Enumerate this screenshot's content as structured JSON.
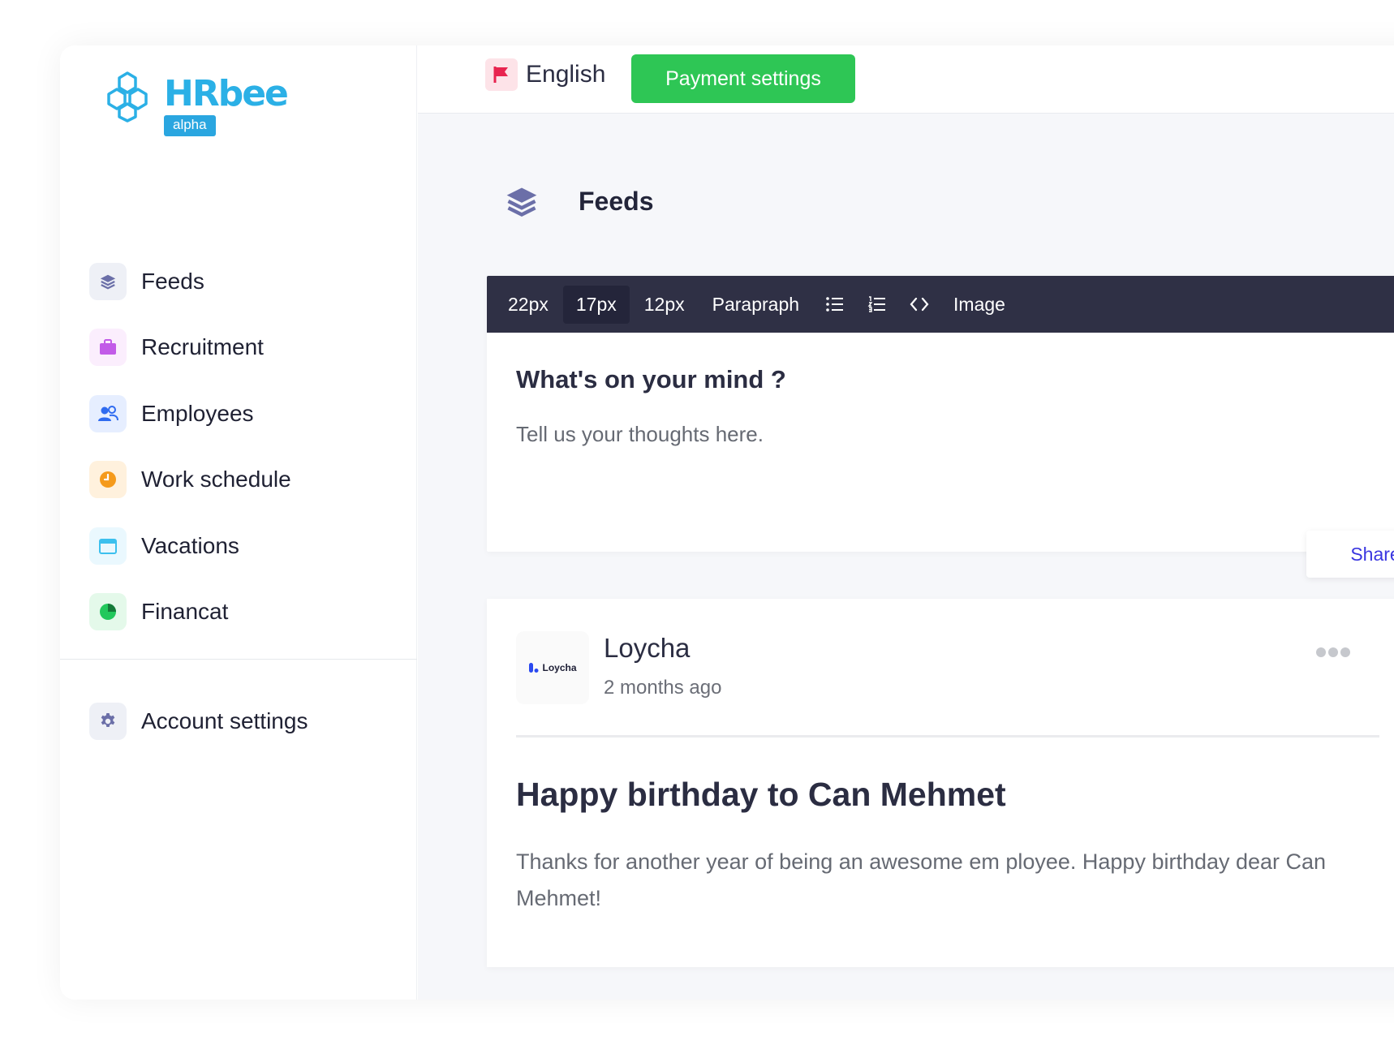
{
  "brand": {
    "name": "HRbee",
    "badge": "alpha"
  },
  "sidebar": {
    "items": [
      {
        "label": "Feeds",
        "icon": "layers-icon",
        "color": "#6b6fa8",
        "bg": "#eef0f6"
      },
      {
        "label": "Recruitment",
        "icon": "briefcase-icon",
        "color": "#c25be8",
        "bg": "#fbeefd"
      },
      {
        "label": "Employees",
        "icon": "users-icon",
        "color": "#2f6bf0",
        "bg": "#e6eeff"
      },
      {
        "label": "Work schedule",
        "icon": "clock-icon",
        "color": "#f59a1b",
        "bg": "#fff1dd"
      },
      {
        "label": "Vacations",
        "icon": "calendar-icon",
        "color": "#3cc0ee",
        "bg": "#eaf8fe"
      },
      {
        "label": "Financat",
        "icon": "pie-chart-icon",
        "color": "#22c85c",
        "bg": "#e4f9ea"
      }
    ],
    "settings": {
      "label": "Account settings",
      "icon": "gear-icon"
    }
  },
  "topbar": {
    "language": "English",
    "payment_button": "Payment settings"
  },
  "page": {
    "title": "Feeds"
  },
  "editor": {
    "toolbar": [
      "22px",
      "17px",
      "12px",
      "Parapraph"
    ],
    "toolbar_active": "17px",
    "image_label": "Image",
    "title_placeholder": "What's on your mind ?",
    "body_placeholder": "Tell us your thoughts here.",
    "share_label": "Share"
  },
  "post": {
    "avatar_text": "Loycha",
    "author": "Loycha",
    "time": "2 months ago",
    "title": "Happy birthday to Can Mehmet",
    "body": "Thanks for another year of being an awesome em ployee. Happy birthday dear Can Mehmet!"
  },
  "colors": {
    "accent_green": "#2ec655",
    "brand_blue": "#2bb0e6",
    "toolbar_bg": "#2f3045",
    "share_text": "#3a36e0"
  }
}
